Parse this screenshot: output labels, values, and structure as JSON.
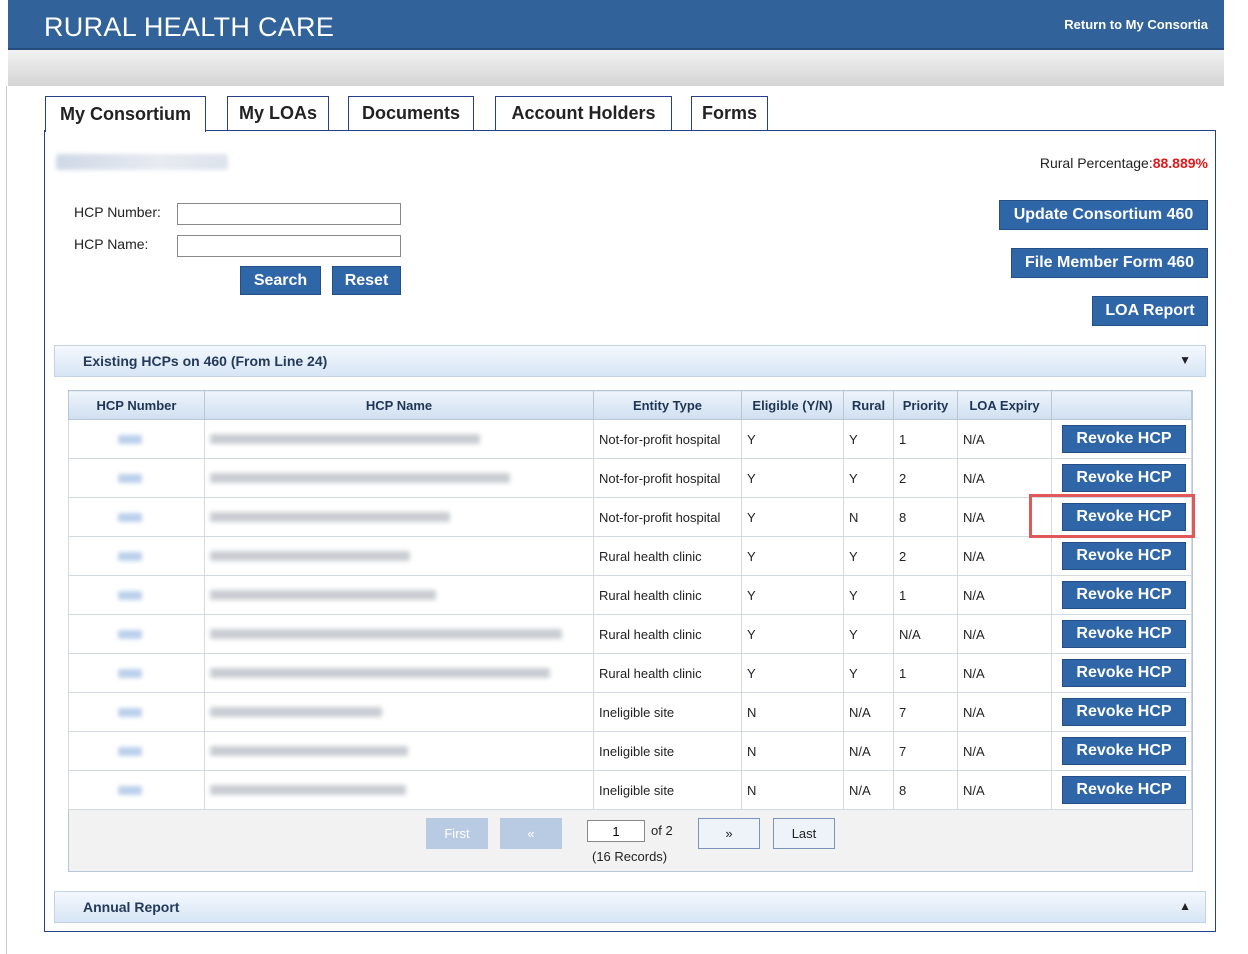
{
  "header": {
    "brand": "RURAL HEALTH CARE",
    "return_link": "Return to My Consortia"
  },
  "tabs": [
    "My Consortium",
    "My LOAs",
    "Documents",
    "Account Holders",
    "Forms"
  ],
  "summary": {
    "rural_label": "Rural Percentage:",
    "rural_value": "88.889%"
  },
  "search": {
    "hcp_number_label": "HCP Number:",
    "hcp_name_label": "HCP Name:",
    "hcp_number_value": "",
    "hcp_name_value": "",
    "search_button": "Search",
    "reset_button": "Reset"
  },
  "actions": {
    "update_consortium": "Update Consortium 460",
    "file_member_form": "File Member Form 460",
    "loa_report": "LOA Report"
  },
  "existing_section": {
    "title": "Existing HCPs on 460 (From Line 24)",
    "columns": [
      "HCP Number",
      "HCP Name",
      "Entity Type",
      "Eligible (Y/N)",
      "Rural",
      "Priority",
      "LOA Expiry",
      ""
    ],
    "revoke_label": "Revoke HCP",
    "rows": [
      {
        "entity_type": "Not-for-profit hospital",
        "eligible": "Y",
        "rural": "Y",
        "priority": "1",
        "loa_expiry": "N/A"
      },
      {
        "entity_type": "Not-for-profit hospital",
        "eligible": "Y",
        "rural": "Y",
        "priority": "2",
        "loa_expiry": "N/A"
      },
      {
        "entity_type": "Not-for-profit hospital",
        "eligible": "Y",
        "rural": "N",
        "priority": "8",
        "loa_expiry": "N/A"
      },
      {
        "entity_type": "Rural health clinic",
        "eligible": "Y",
        "rural": "Y",
        "priority": "2",
        "loa_expiry": "N/A"
      },
      {
        "entity_type": "Rural health clinic",
        "eligible": "Y",
        "rural": "Y",
        "priority": "1",
        "loa_expiry": "N/A"
      },
      {
        "entity_type": "Rural health clinic",
        "eligible": "Y",
        "rural": "Y",
        "priority": "N/A",
        "loa_expiry": "N/A"
      },
      {
        "entity_type": "Rural health clinic",
        "eligible": "Y",
        "rural": "Y",
        "priority": "1",
        "loa_expiry": "N/A"
      },
      {
        "entity_type": "Ineligible site",
        "eligible": "N",
        "rural": "N/A",
        "priority": "7",
        "loa_expiry": "N/A"
      },
      {
        "entity_type": "Ineligible site",
        "eligible": "N",
        "rural": "N/A",
        "priority": "7",
        "loa_expiry": "N/A"
      },
      {
        "entity_type": "Ineligible site",
        "eligible": "N",
        "rural": "N/A",
        "priority": "8",
        "loa_expiry": "N/A"
      }
    ]
  },
  "pager": {
    "first": "First",
    "prev": "«",
    "next": "»",
    "last": "Last",
    "page_value": "1",
    "of_text": "of 2",
    "records_text": "(16 Records)"
  },
  "annual_section": {
    "title": "Annual Report"
  },
  "colors": {
    "brand_blue": "#31629a",
    "button_blue": "#2f66a8",
    "rural_red": "#e01a1a",
    "highlight_red": "#e05858"
  },
  "icons": {
    "collapse": "double-chevron-down-icon",
    "expand": "double-chevron-up-icon"
  }
}
